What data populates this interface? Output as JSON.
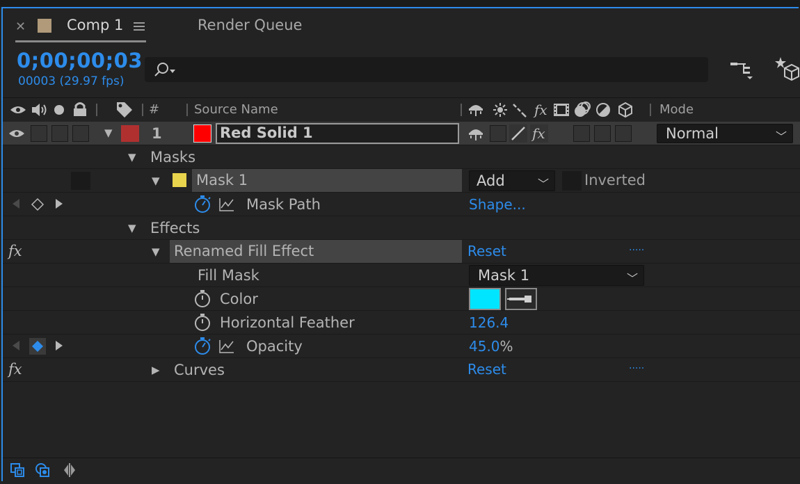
{
  "tabs": [
    {
      "label": "Comp 1",
      "active": true,
      "swatch": "#b09a7a"
    },
    {
      "label": "Render Queue",
      "active": false
    }
  ],
  "header": {
    "timecode": "0;00;00;03",
    "frame_info": "00003 (29.97 fps)",
    "search_placeholder": ""
  },
  "columns": {
    "number": "#",
    "source_name": "Source Name",
    "mode": "Mode"
  },
  "layer": {
    "index": "1",
    "name": "Red Solid 1",
    "color": "#ff0000",
    "label_color": "#b03030",
    "mode": "Normal"
  },
  "masks_group": "Masks",
  "mask": {
    "name": "Mask 1",
    "color": "#e8d44d",
    "mode": "Add",
    "inverted_label": "Inverted",
    "path_label": "Mask Path",
    "path_value": "Shape..."
  },
  "effects_group": "Effects",
  "effect": {
    "name": "Renamed Fill Effect",
    "reset": "Reset",
    "dots": ".....",
    "fill_mask_label": "Fill Mask",
    "fill_mask_value": "Mask 1",
    "color_label": "Color",
    "color_value": "#00e5ff",
    "feather_label": "Horizontal Feather",
    "feather_value": "126.4",
    "opacity_label": "Opacity",
    "opacity_value": "45.0",
    "opacity_unit": "%"
  },
  "curves": {
    "name": "Curves",
    "reset": "Reset",
    "dots": "....."
  },
  "icons": [
    "close-icon",
    "menu-icon",
    "search-icon",
    "flowchart-icon",
    "render-icon",
    "eye-icon",
    "audio-icon",
    "solo-icon",
    "lock-icon",
    "label-icon",
    "stopwatch-icon",
    "graph-icon",
    "fx-icon",
    "keyframe-icon",
    "eyedropper-icon"
  ],
  "accent": "#2d8ceb"
}
